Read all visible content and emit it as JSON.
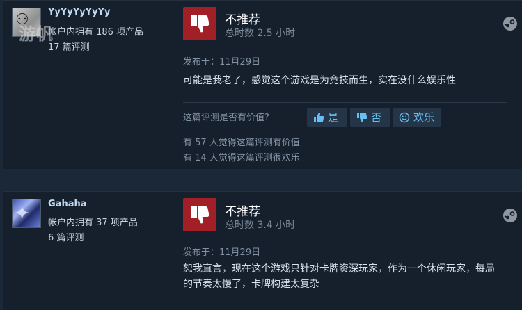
{
  "reviews": [
    {
      "username": "YyYyYyYyYy",
      "products_owned": "帐户内拥有 186 项产品",
      "reviews_count": "17 篇评测",
      "watermark": "游帆",
      "verdict": "不推荐",
      "hours": "总时数 2.5 小时",
      "posted": "发布于：11月29日",
      "content": "可能是我老了，感觉这个游戏是为竞技而生，实在没什么娱乐性",
      "helpful_question": "这篇评测是否有价值?",
      "yes_label": "是",
      "no_label": "否",
      "funny_label": "欢乐",
      "helpful_stat": "有 57 人觉得这篇评测有价值",
      "funny_stat": "有 14 人觉得这篇评测很欢乐"
    },
    {
      "username": "Gahaha",
      "products_owned": "帐户内拥有 37 项产品",
      "reviews_count": "6 篇评测",
      "verdict": "不推荐",
      "hours": "总时数 3.4 小时",
      "posted": "发布于：11月29日",
      "content": "恕我直言，现在这个游戏只针对卡牌资深玩家，作为一个休闲玩家，每局的节奏太慢了，卡牌构建太复杂"
    }
  ],
  "icons": {
    "thumbs_down": "thumbs-down-icon",
    "steam": "steam-icon",
    "thumbs_up": "thumbs-up-icon",
    "smile": "smile-icon"
  },
  "colors": {
    "background": "#1b2838",
    "card": "#16202d",
    "not_recommended": "#a11f26",
    "link_blue": "#66c0f4"
  }
}
